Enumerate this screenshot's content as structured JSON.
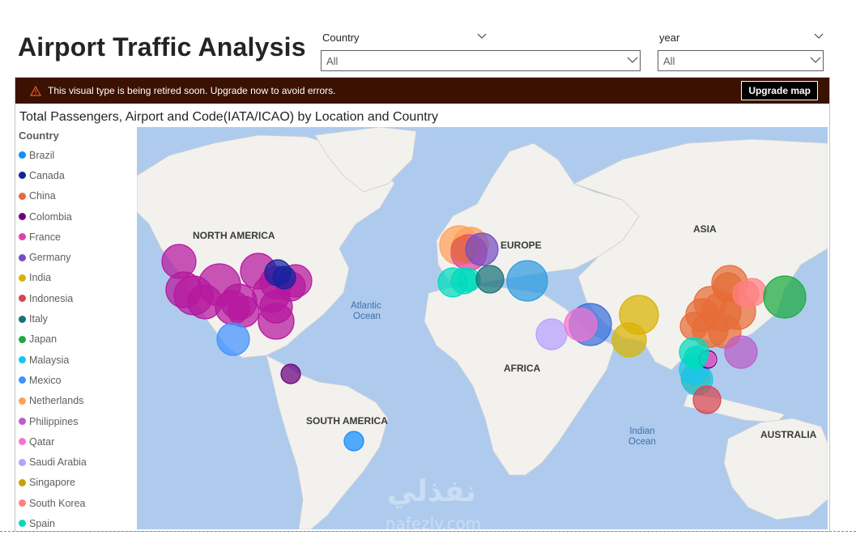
{
  "page": {
    "title": "Airport Traffic Analysis"
  },
  "slicers": [
    {
      "label": "Country",
      "value": "All"
    },
    {
      "label": "year",
      "value": "All"
    }
  ],
  "warning": {
    "message": "This visual type is being retired soon. Upgrade now to avoid errors.",
    "button_label": "Upgrade map"
  },
  "visual": {
    "title": "Total Passengers, Airport and Code(IATA/ICAO) by Location and Country"
  },
  "legend": {
    "title": "Country",
    "items": [
      {
        "label": "Brazil",
        "color": "#118DFF"
      },
      {
        "label": "Canada",
        "color": "#12239E"
      },
      {
        "label": "China",
        "color": "#E66C37"
      },
      {
        "label": "Colombia",
        "color": "#6B007B"
      },
      {
        "label": "France",
        "color": "#E044A7"
      },
      {
        "label": "Germany",
        "color": "#744EC2"
      },
      {
        "label": "India",
        "color": "#D9B300"
      },
      {
        "label": "Indonesia",
        "color": "#D64550"
      },
      {
        "label": "Italy",
        "color": "#197278"
      },
      {
        "label": "Japan",
        "color": "#1AAB40"
      },
      {
        "label": "Malaysia",
        "color": "#15C6F4"
      },
      {
        "label": "Mexico",
        "color": "#4092FF"
      },
      {
        "label": "Netherlands",
        "color": "#FFA058"
      },
      {
        "label": "Philippines",
        "color": "#BE5DC9"
      },
      {
        "label": "Qatar",
        "color": "#F472D0"
      },
      {
        "label": "Saudi Arabia",
        "color": "#B5A1FF"
      },
      {
        "label": "Singapore",
        "color": "#C4A200"
      },
      {
        "label": "South Korea",
        "color": "#FF8080"
      },
      {
        "label": "Spain",
        "color": "#00DBBC"
      }
    ]
  },
  "map": {
    "labels": {
      "north_america": "NORTH AMERICA",
      "south_america": "SOUTH AMERICA",
      "europe": "EUROPE",
      "africa": "AFRICA",
      "asia": "ASIA",
      "australia": "AUSTRALIA",
      "atlantic_1": "Atlantic",
      "atlantic_2": "Ocean",
      "indian_1": "Indian",
      "indian_2": "Ocean"
    },
    "ocean_color": "#AECBEE",
    "land_color": "#F2F1EE"
  },
  "watermark": {
    "text_ar": "نفذلي",
    "text_en": "nafezly.com"
  }
}
